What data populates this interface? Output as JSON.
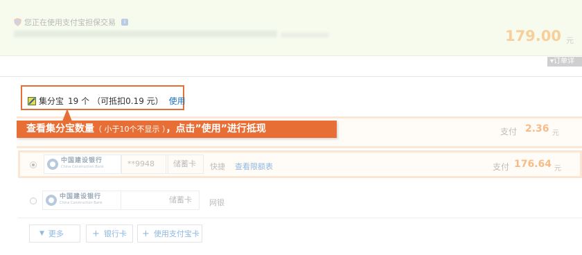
{
  "order": {
    "notice": "您正在使用支付宝担保交易",
    "amount": "179.00",
    "currency": "元",
    "detail_link": "订单详"
  },
  "jifen": {
    "name": "集分宝",
    "count": "19 个",
    "deduct": "（可抵扣0.19 元）",
    "use_link": "使用"
  },
  "callout": {
    "prefix": "查看集分宝数量",
    "note": "（ 小于10个不显示 ）",
    "suffix": "，点击”使用”进行抵现"
  },
  "row_jifen_pay": {
    "label": "支付",
    "amount": "2.36",
    "currency": "元"
  },
  "banks": [
    {
      "selected": true,
      "bank_cn": "中国建设银行",
      "bank_en": "China Construction Bank",
      "card_number": "**9948",
      "card_type": "储蓄卡",
      "method": "快捷",
      "limit_link": "查看限额表",
      "pay_label": "支付",
      "pay_amount": "176.64",
      "currency": "元"
    },
    {
      "selected": false,
      "bank_cn": "中国建设银行",
      "bank_en": "China Construction Bank",
      "card_type": "储蓄卡",
      "method": "网银"
    }
  ],
  "actions": {
    "more": "更多",
    "bank_card": "银行卡",
    "alipay_card": "使用支付宝卡"
  },
  "colors": {
    "accent": "#e76e34",
    "link": "#1970c5",
    "amount": "#f6bb87"
  }
}
